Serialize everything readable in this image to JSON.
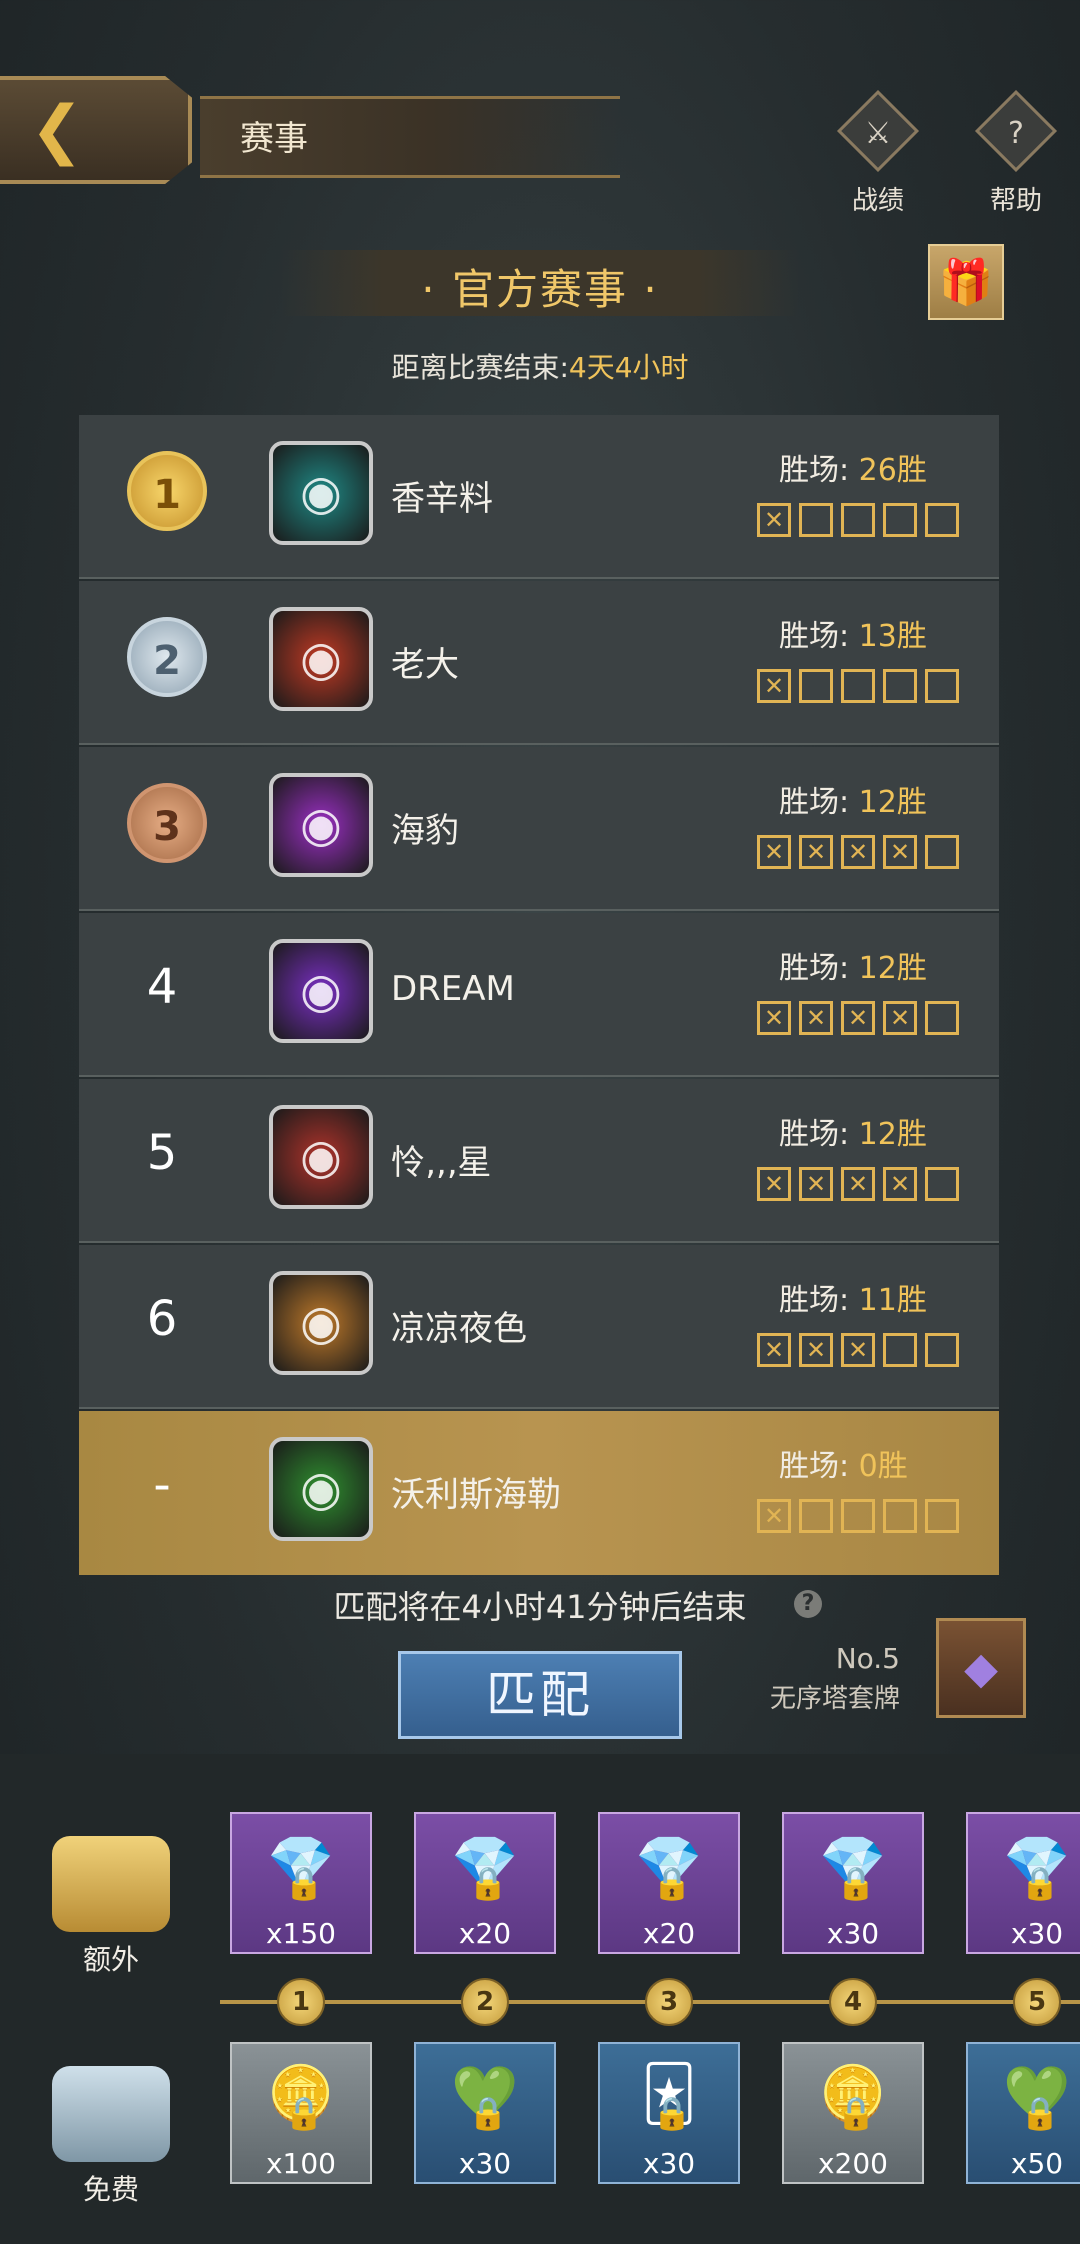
{
  "header": {
    "back_icon": "back-arrow-icon",
    "title": "赛事",
    "actions": [
      {
        "label": "战绩",
        "icon": "record-icon"
      },
      {
        "label": "帮助",
        "icon": "help-icon"
      }
    ]
  },
  "section": {
    "title": "· 官方赛事 ·",
    "gift_icon": "gift-icon",
    "countdown_label": "距离比赛结束:",
    "countdown_value": "4天4小时"
  },
  "rankings": [
    {
      "rank": "1",
      "name": "香辛料",
      "wins_label": "胜场:",
      "wins": "26胜",
      "marks": [
        true,
        false,
        false,
        false,
        false
      ],
      "avatar_color": "#1f8a86"
    },
    {
      "rank": "2",
      "name": "老大",
      "wins_label": "胜场:",
      "wins": "13胜",
      "marks": [
        true,
        false,
        false,
        false,
        false
      ],
      "avatar_color": "#c23a24"
    },
    {
      "rank": "3",
      "name": "海豹",
      "wins_label": "胜场:",
      "wins": "12胜",
      "marks": [
        true,
        true,
        true,
        true,
        false
      ],
      "avatar_color": "#9b2fc4"
    },
    {
      "rank": "4",
      "name": "DREAM",
      "wins_label": "胜场:",
      "wins": "12胜",
      "marks": [
        true,
        true,
        true,
        true,
        false
      ],
      "avatar_color": "#7a2fc4"
    },
    {
      "rank": "5",
      "name": "怜‚‚‚星",
      "wins_label": "胜场:",
      "wins": "12胜",
      "marks": [
        true,
        true,
        true,
        true,
        false
      ],
      "avatar_color": "#b0332b"
    },
    {
      "rank": "6",
      "name": "凉凉夜色",
      "wins_label": "胜场:",
      "wins": "11胜",
      "marks": [
        true,
        true,
        true,
        false,
        false
      ],
      "avatar_color": "#c07a2a"
    },
    {
      "rank": "-",
      "name": "沃利斯海勒",
      "wins_label": "胜场:",
      "wins": "0胜",
      "marks": [
        true,
        false,
        false,
        false,
        false
      ],
      "avatar_color": "#2f8f2f"
    }
  ],
  "match": {
    "end_text": "匹配将在4小时41分钟后结束",
    "help_glyph": "?",
    "button_label": "匹配",
    "tier_no": "No.5",
    "tier_name": "无序塔套牌"
  },
  "rewards": {
    "extra_label": "额外",
    "free_label": "免费",
    "extra_items": [
      "x150",
      "x20",
      "x20",
      "x30",
      "x30"
    ],
    "free_items": [
      "x100",
      "x30",
      "x30",
      "x200",
      "x50"
    ],
    "nodes": [
      "1",
      "2",
      "3",
      "4",
      "5"
    ]
  }
}
